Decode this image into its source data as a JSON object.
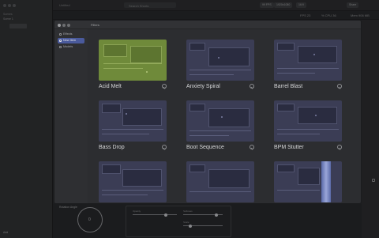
{
  "app": {
    "title": "Untitled",
    "sidebar": {
      "header": "Scenes",
      "item": "Scene 1",
      "footer": "Add"
    },
    "topbar": {
      "search_placeholder": "Search Shorts",
      "pills": [
        "99 FPS",
        "1920x1080",
        "16:9",
        "Full"
      ],
      "share": "Share"
    },
    "status": {
      "fps": "FPS 23",
      "cpu": "% CPU 36",
      "mem": "Mem 906 MB"
    },
    "bottom": {
      "dial_label": "Rotation Angle",
      "dial_value": "0",
      "controls": [
        "Opacity",
        "Softness",
        "Scale",
        "Speed"
      ]
    }
  },
  "modal": {
    "title": "Filters",
    "sidebar": [
      {
        "label": "Effects",
        "icon": "sparkle-icon"
      },
      {
        "label": "New Item",
        "icon": "plus-icon"
      },
      {
        "label": "Models",
        "icon": "cube-icon"
      }
    ],
    "cards": [
      {
        "label": "Acid Melt",
        "tint": "#6f8a3a"
      },
      {
        "label": "Anxiety Spiral",
        "tint": "#3b3d55"
      },
      {
        "label": "Barrel Blast",
        "tint": "#3b3d55"
      },
      {
        "label": "Bass Drop",
        "tint": "#3b3d55"
      },
      {
        "label": "Boot Sequence",
        "tint": "#3b3d55"
      },
      {
        "label": "BPM Stutter",
        "tint": "#3b3d55"
      },
      {
        "label": "",
        "tint": "#3b3d55"
      },
      {
        "label": "",
        "tint": "#3b3d55"
      },
      {
        "label": "",
        "tint": "#3b3d55"
      }
    ]
  },
  "colors": {
    "accent_selected": "#4a5a9c",
    "acid_tint": "#6f8a3a"
  }
}
